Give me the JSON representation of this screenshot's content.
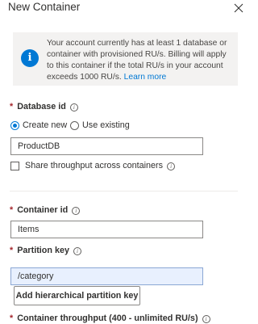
{
  "dialog": {
    "title": "New Container",
    "close_icon": "close-icon"
  },
  "info": {
    "icon": "info-icon",
    "text": "Your account currently has at least 1 database or container with provisioned RU/s. Billing will apply to this container if the total RU/s in your account exceeds 1000 RU/s.",
    "link": "Learn more"
  },
  "database": {
    "required_mark": "*",
    "label": "Database id",
    "help_icon": "i",
    "radio_create": "Create new",
    "radio_existing": "Use existing",
    "selected": "Create new",
    "value": "ProductDB",
    "share_label": "Share throughput across containers",
    "share_checked": false
  },
  "container": {
    "required_mark": "*",
    "label": "Container id",
    "help_icon": "i",
    "value": "Items"
  },
  "partition": {
    "required_mark": "*",
    "label": "Partition key",
    "help_icon": "i",
    "value": "/category",
    "add_button": "Add hierarchical partition key"
  },
  "throughput": {
    "required_mark": "*",
    "label": "Container throughput (400 - unlimited RU/s)",
    "help_icon": "i"
  },
  "colors": {
    "accent": "#0078d4",
    "required": "#a4262c",
    "info_bg": "#f3f2f1"
  }
}
